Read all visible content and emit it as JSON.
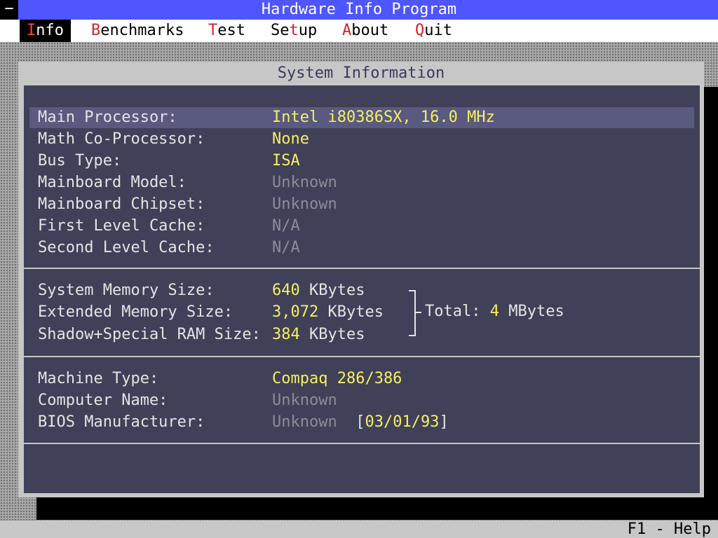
{
  "titlebar": {
    "system_menu": "−",
    "title": "Hardware Info Program"
  },
  "menu": [
    {
      "hot": "I",
      "rest": "nfo"
    },
    {
      "hot": "B",
      "rest": "enchmarks"
    },
    {
      "hot": "T",
      "rest": "est"
    },
    {
      "pre": "Se",
      "hot": "t",
      "rest": "up"
    },
    {
      "hot": "A",
      "rest": "bout"
    },
    {
      "hot": "Q",
      "rest": "uit"
    }
  ],
  "window": {
    "title": "System Information"
  },
  "processor_section": [
    {
      "label": "Main Processor:",
      "value": "Intel i80386SX, 16.0 MHz"
    },
    {
      "label": "Math Co-Processor:",
      "value": "None"
    },
    {
      "label": "Bus Type:",
      "value": "ISA"
    },
    {
      "label": "Mainboard Model:",
      "value": "Unknown"
    },
    {
      "label": "Mainboard Chipset:",
      "value": "Unknown"
    },
    {
      "label": "First Level Cache:",
      "value": "N/A"
    },
    {
      "label": "Second Level Cache:",
      "value": "N/A"
    }
  ],
  "memory_section": [
    {
      "label": "System Memory Size:",
      "amount": "640",
      "unit": "KBytes"
    },
    {
      "label": "Extended Memory Size:",
      "amount": "3,072",
      "unit": "KBytes"
    },
    {
      "label": "Shadow+Special RAM Size:",
      "amount": "384",
      "unit": "KBytes"
    }
  ],
  "memory_total": {
    "label": "Total:",
    "amount": "4",
    "unit": "MBytes"
  },
  "machine_section": [
    {
      "label": "Machine Type:",
      "value": "Compaq 286/386"
    },
    {
      "label": "Computer Name:",
      "value": "Unknown"
    },
    {
      "label": "BIOS Manufacturer:",
      "value": "Unknown",
      "bracket_open": "[",
      "date": "03/01/93",
      "bracket_close": "]"
    }
  ],
  "statusbar": {
    "help": "F1 - Help"
  },
  "colors": {
    "title_bar": "#4f55ff",
    "value_yellow": "#f5f062",
    "value_unknown": "#8c8c9a",
    "panel": "#404058",
    "menu_hotkey": "#d2232a"
  }
}
